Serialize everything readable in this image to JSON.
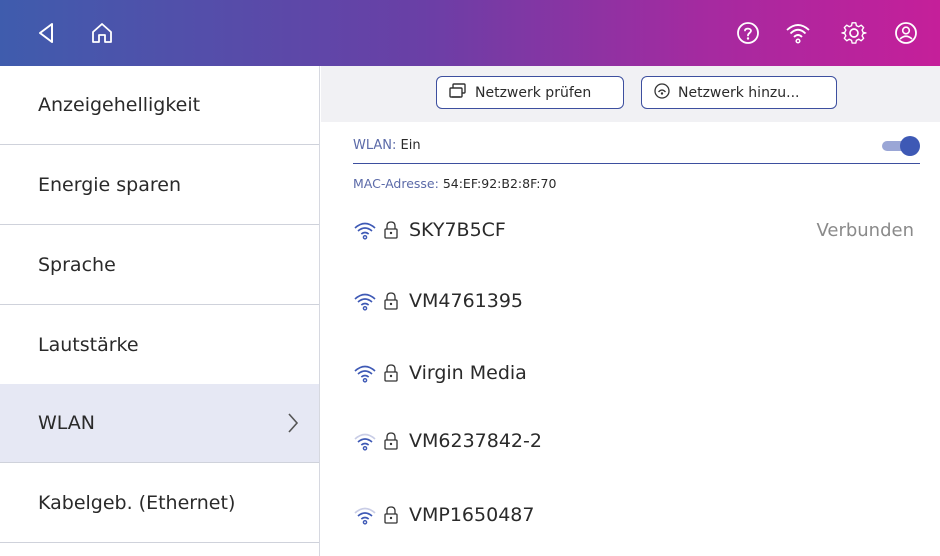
{
  "topbar": {
    "icons": [
      "back-arrow-icon",
      "home-icon",
      "help-icon",
      "wifi-icon",
      "settings-gear-icon",
      "account-icon"
    ]
  },
  "sidebar": {
    "items": [
      {
        "label": "Anzeigehelligkeit"
      },
      {
        "label": "Energie sparen"
      },
      {
        "label": "Sprache"
      },
      {
        "label": "Lautstärke"
      },
      {
        "label": "WLAN",
        "active": true
      },
      {
        "label": "Kabelgeb. (Ethernet)"
      }
    ]
  },
  "toolbar": {
    "check_network_label": "Netzwerk prüfen",
    "add_network_label": "Netzwerk hinzu..."
  },
  "wlan": {
    "label": "WLAN:",
    "value": "Ein",
    "enabled": true
  },
  "mac": {
    "label": "MAC-Adresse:",
    "value": "54:EF:92:B2:8F:70"
  },
  "networks": [
    {
      "ssid": "SKY7B5CF",
      "status": "Verbunden",
      "signal": 4,
      "secured": true
    },
    {
      "ssid": "VM4761395",
      "status": "",
      "signal": 4,
      "secured": true
    },
    {
      "ssid": "Virgin Media",
      "status": "",
      "signal": 4,
      "secured": true
    },
    {
      "ssid": "VM6237842-2",
      "status": "",
      "signal": 3,
      "secured": true
    },
    {
      "ssid": "VMP1650487",
      "status": "",
      "signal": 3,
      "secured": true
    }
  ],
  "colors": {
    "accent": "#3e59b5",
    "active_bg": "#e6e8f4",
    "gradient_start": "#3f5cad",
    "gradient_end": "#c51f9a"
  }
}
